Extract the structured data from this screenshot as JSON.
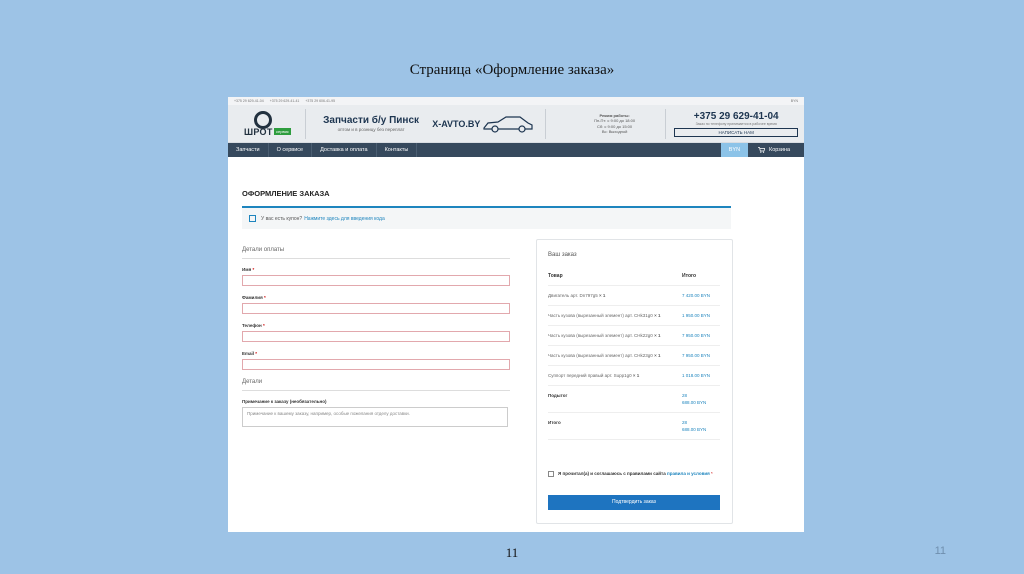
{
  "slide": {
    "title": "Страница «Оформление заказа»",
    "page_number": "11",
    "corner_number": "11"
  },
  "site": {
    "topbar": {
      "phones": [
        "+375 29 629-41-04",
        "+375 29 629-41-41",
        "+375 29 606-41-95"
      ],
      "currency": "BYN"
    },
    "logo_text": "ШРОТ",
    "logo_badge": "сервис",
    "slogan_title": "Запчасти б/у Пинск",
    "slogan_sub": "оптом и в розницу без переплат",
    "site_name": "X-AVTO.BY",
    "hours": [
      "Режим работы:",
      "Пн-Пт: с 9:00 до 18:00",
      "Сб: с 9:00 до 15:00",
      "Вс: Выходной"
    ],
    "phone": "+375 29 629-41-04",
    "phone_note": "Заказ по телефону принимается в рабочее время",
    "write_button": "НАПИСАТЬ НАМ",
    "nav": [
      "Запчасти",
      "О сервисе",
      "Доставка и оплата",
      "Контакты"
    ],
    "nav_currency": "BYN",
    "cart_label": "Корзина",
    "heading": "ОФОРМЛЕНИЕ ЗАКАЗА",
    "coupon_text": "У вас есть купон?",
    "coupon_link": "Нажмите здесь для введения кода",
    "billing_title": "Детали оплаты",
    "fields": [
      {
        "label": "Имя"
      },
      {
        "label": "Фамилия"
      },
      {
        "label": "Телефон"
      },
      {
        "label": "Email"
      }
    ],
    "details_title": "Детали",
    "notes_label": "Примечание к заказу (необязательно)",
    "notes_placeholder": "Примечание к вашему заказу, например, особые пожелания отделу доставки.",
    "order": {
      "title": "Ваш заказ",
      "col_product": "Товар",
      "col_total": "Итого",
      "items": [
        {
          "name": "Двигатель арт. Dn797g5",
          "qty": "× 1",
          "price": "7 420.00 BYN"
        },
        {
          "name": "Часть кузова (вырезанный элемент) арт. CHk31g0",
          "qty": "× 1",
          "price": "1 950.00 BYN"
        },
        {
          "name": "Часть кузова (вырезанный элемент) арт. CHk22g0",
          "qty": "× 1",
          "price": "7 950.00 BYN"
        },
        {
          "name": "Часть кузова (вырезанный элемент) арт. CHk23g0",
          "qty": "× 1",
          "price": "7 950.00 BYN"
        },
        {
          "name": "Суппорт передний правый арт. Supp1g0",
          "qty": "× 1",
          "price": "1 018.00 BYN"
        }
      ],
      "subtotal_label": "Подытог",
      "subtotal_value_a": "28",
      "subtotal_value_b": "688.00 BYN",
      "total_label": "Итого",
      "total_value_a": "28",
      "total_value_b": "688.00 BYN",
      "consent_text": "Я прочитал(а) и соглашаюсь с правилами сайта",
      "consent_link": "правила и условия",
      "confirm_button": "Подтвердить заказ"
    }
  }
}
